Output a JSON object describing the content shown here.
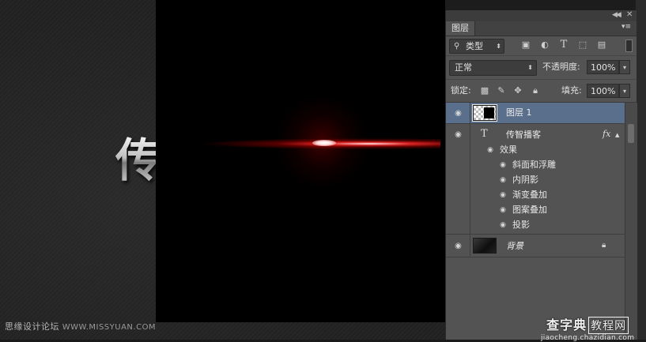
{
  "canvas": {
    "bg_text": "传",
    "watermark_cn": "思缘设计论坛",
    "watermark_en": "WWW.MISSYUAN.COM"
  },
  "panel": {
    "tab_label": "图层",
    "filter": {
      "label": "类型"
    },
    "blend_mode": "正常",
    "opacity_label": "不透明度:",
    "opacity_value": "100%",
    "lock_label": "锁定:",
    "fill_label": "填充:",
    "fill_value": "100%",
    "layers": [
      {
        "name": "图层 1",
        "type": "pixel",
        "selected": true,
        "visible": true
      },
      {
        "name": "传智播客",
        "type": "text",
        "selected": false,
        "visible": true,
        "fx": "fx",
        "effects_label": "效果",
        "effects": [
          "斜面和浮雕",
          "内阴影",
          "渐变叠加",
          "图案叠加",
          "投影"
        ]
      },
      {
        "name": "背景",
        "type": "background",
        "selected": false,
        "visible": true,
        "locked": true
      }
    ]
  },
  "site_watermark": {
    "cn_main": "查字典",
    "cn_boxed": "教程网",
    "domain": "jiaocheng.chazidian.com"
  },
  "icons": {
    "eye": "eye-icon",
    "lock": "lock-icon",
    "text_layer": "text-layer-icon",
    "search": "search-icon"
  },
  "colors": {
    "panel_bg": "#535353",
    "selected_layer": "#5a6f8c",
    "glow_red": "#ff2a2a"
  }
}
